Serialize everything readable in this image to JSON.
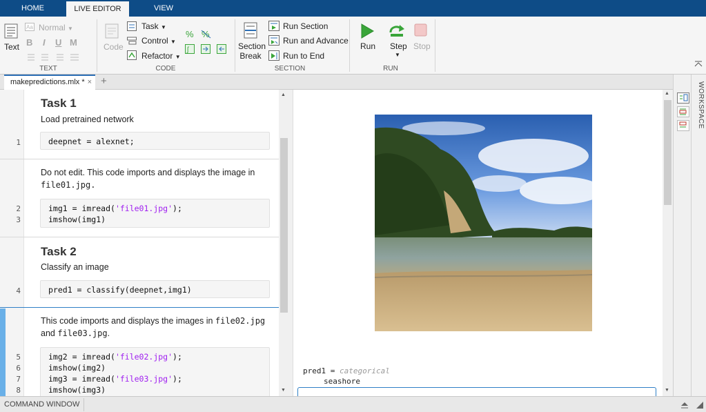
{
  "tabs": {
    "home": "HOME",
    "live_editor": "LIVE EDITOR",
    "view": "VIEW"
  },
  "ribbon": {
    "text_group": {
      "label": "TEXT",
      "text_button": "Text",
      "style_value": "Normal",
      "bold": "B",
      "italic": "I",
      "underline": "U",
      "mono": "M"
    },
    "code_group": {
      "label": "CODE",
      "code_button": "Code",
      "task": "Task",
      "control": "Control",
      "refactor": "Refactor"
    },
    "section_group": {
      "label": "SECTION",
      "section_break_line1": "Section",
      "section_break_line2": "Break",
      "run_section": "Run Section",
      "run_and_advance": "Run and Advance",
      "run_to_end": "Run to End"
    },
    "run_group": {
      "label": "RUN",
      "run": "Run",
      "step": "Step",
      "stop": "Stop"
    }
  },
  "document": {
    "tab_name": "makepredictions.mlx *",
    "close": "×",
    "new_tab": "+"
  },
  "editor": {
    "task1_heading": "Task 1",
    "task1_text": "Load pretrained network",
    "line1": "deepnet = alexnet;",
    "note1_line1": "Do not edit. This code imports and displays the image in",
    "note1_line2": "file01.jpg.",
    "line2_a": "img1 = imread(",
    "line2_str": "'file01.jpg'",
    "line2_b": ");",
    "line3": "imshow(img1)",
    "task2_heading": "Task 2",
    "task2_text": "Classify an image",
    "line4": "pred1 = classify(deepnet,img1)",
    "note2_line1_a": "This code imports and displays the images in ",
    "note2_line1_code": "file02.jpg",
    "note2_line2_a": " and ",
    "note2_line2_code": "file03.jpg",
    "note2_line2_b": ".",
    "line5_a": "img2 = imread(",
    "line5_str": "'file02.jpg'",
    "line5_b": ");",
    "line6": "imshow(img2)",
    "line7_a": "img3 = imread(",
    "line7_str": "'file03.jpg'",
    "line7_b": ");",
    "line8": "imshow(img3)",
    "line_numbers": [
      "1",
      "2",
      "3",
      "4",
      "5",
      "6",
      "7",
      "8"
    ]
  },
  "output": {
    "var_name": "pred1 = ",
    "var_type": "categorical",
    "var_value": "seashore"
  },
  "side_panel": {
    "workspace_label": "WORKSPACE"
  },
  "command_window": {
    "label": "COMMAND WINDOW"
  },
  "colors": {
    "tab_strip": "#0e4c87",
    "run_green": "#3aa53a",
    "string_purple": "#a020f0",
    "active_blue": "#2e7fc6"
  },
  "icons": [
    "text-icon",
    "code-icon",
    "task-icon",
    "control-icon",
    "refactor-icon",
    "section-break-icon",
    "run-section-icon",
    "run-advance-icon",
    "run-to-end-icon",
    "run-icon",
    "step-icon",
    "stop-icon"
  ]
}
